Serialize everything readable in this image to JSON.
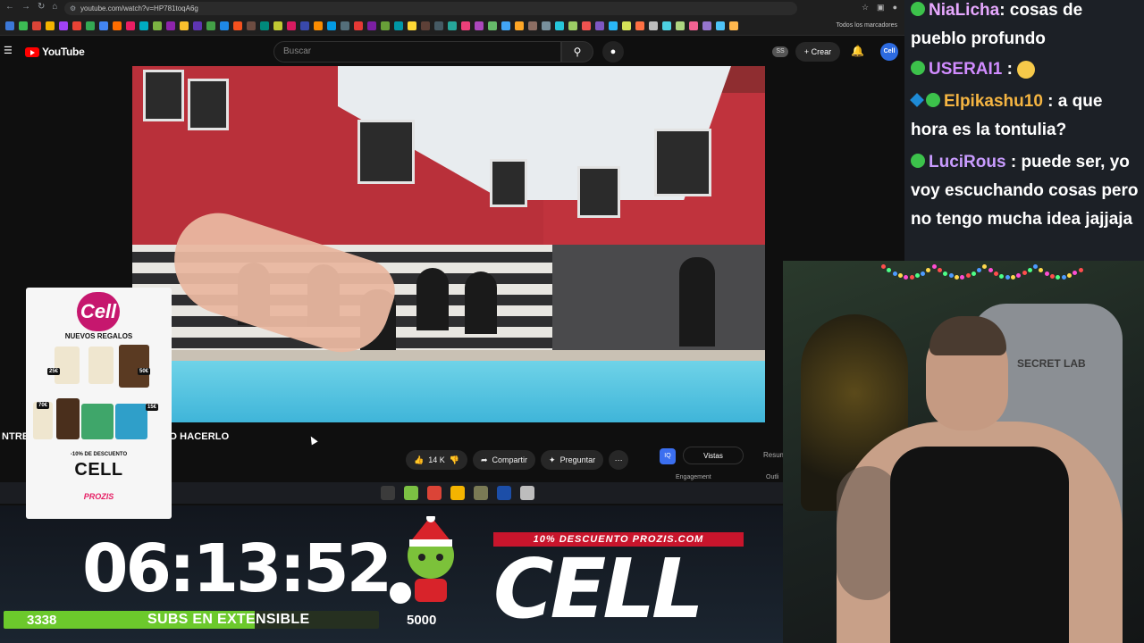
{
  "browser": {
    "url": "youtube.com/watch?v=HP781toqA6g",
    "bookmarks_all": "Todos los marcadores",
    "bookmark_colors": [
      "#3c78d8",
      "#3cba54",
      "#db4437",
      "#f4b400",
      "#a142f4",
      "#ea4335",
      "#34a853",
      "#4285f4",
      "#ff6d00",
      "#e91e63",
      "#00acc1",
      "#7cb342",
      "#8e24aa",
      "#fbc02d",
      "#5e35b1",
      "#43a047",
      "#1e88e5",
      "#f4511e",
      "#6d4c41",
      "#00897b",
      "#c0ca33",
      "#d81b60",
      "#3949ab",
      "#fb8c00",
      "#039be5",
      "#546e7a",
      "#e53935",
      "#7b1fa2",
      "#689f38",
      "#0097a7",
      "#fdd835",
      "#5d4037",
      "#455a64",
      "#26a69a",
      "#ec407a",
      "#ab47bc",
      "#66bb6a",
      "#42a5f5",
      "#ffa726",
      "#8d6e63",
      "#78909c",
      "#26c6da",
      "#9ccc65",
      "#ef5350",
      "#7e57c2",
      "#29b6f6",
      "#d4e157",
      "#ff7043",
      "#bdbdbd",
      "#4dd0e1",
      "#aed581",
      "#f06292",
      "#9575cd",
      "#4fc3f7",
      "#ffb74d"
    ]
  },
  "youtube": {
    "logo_text": "YouTube",
    "search_placeholder": "Buscar",
    "ss_badge": "SS",
    "create_label": "Crear",
    "avatar_text": "Cell",
    "video_title": "NTRE                                    NDAN NO HACERLO",
    "likes": "14 K",
    "share_label": "Compartir",
    "ask_label": "Preguntar",
    "side_ia": "IQ",
    "side_views": "Vistas",
    "side_resumen": "Resum",
    "side_engagement": "Engagement",
    "side_outline": "Outli"
  },
  "taskbar": {
    "colors": [
      "#3b3b3b",
      "#7bc043",
      "#db4437",
      "#f4b400",
      "#7a7a55",
      "#1c4ea8",
      "#bdbdbd"
    ]
  },
  "ad": {
    "logo": "Cell",
    "title": "NUEVOS REGALOS",
    "prices": [
      "25€",
      "50€",
      "70€",
      "15€"
    ],
    "discount": "-10% DE DESCUENTO",
    "code": "CELL",
    "brand": "PROZIS"
  },
  "overlay": {
    "timer": "06:13:52",
    "subs_current": "3338",
    "subs_label": "SUBS EN EXTENSIBLE",
    "subs_goal": "5000",
    "progress_fraction": 0.67,
    "promo_banner": "10% DESCUENTO PROZIS.COM",
    "promo_code": "CELL"
  },
  "chat": {
    "messages": [
      {
        "user": "NiaLicha",
        "color": "#e7a8ff",
        "text": ": cosas de pueblo profundo",
        "badges": [
          "green"
        ]
      },
      {
        "user": "USERAI1",
        "color": "#d18cff",
        "text": " : ",
        "emoji": "slight-smile",
        "badges": [
          "green"
        ]
      },
      {
        "user": "Elpikashu10",
        "color": "#f5b542",
        "text": " : a que hora es la tontulia?",
        "badges": [
          "cube",
          "green"
        ]
      },
      {
        "user": "LuciRous",
        "color": "#c99cff",
        "text": " : puede ser, yo voy escuchando cosas pero no tengo mucha idea jajjaja",
        "badges": [
          "green"
        ]
      }
    ]
  },
  "webcam": {
    "chair_brand": "SECRET LAB"
  }
}
